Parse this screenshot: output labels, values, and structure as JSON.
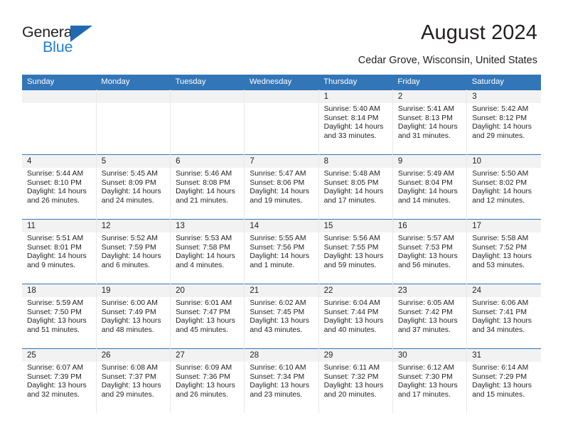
{
  "brand": {
    "name_part1": "General",
    "name_part2": "Blue",
    "triangle_color": "#1f69b0",
    "blue_text_color": "#1f7fd4"
  },
  "header": {
    "title": "August 2024",
    "subtitle": "Cedar Grove, Wisconsin, United States",
    "header_bg_color": "#3276b8",
    "daynum_bg_color": "#f2f2f2"
  },
  "weekday_headers": [
    "Sunday",
    "Monday",
    "Tuesday",
    "Wednesday",
    "Thursday",
    "Friday",
    "Saturday"
  ],
  "labels": {
    "sunrise_prefix": "Sunrise:",
    "sunset_prefix": "Sunset:",
    "daylight_prefix": "Daylight:"
  },
  "weeks": [
    [
      {
        "day": "",
        "sunrise": "",
        "sunset": "",
        "daylight_line1": "",
        "daylight_line2": ""
      },
      {
        "day": "",
        "sunrise": "",
        "sunset": "",
        "daylight_line1": "",
        "daylight_line2": ""
      },
      {
        "day": "",
        "sunrise": "",
        "sunset": "",
        "daylight_line1": "",
        "daylight_line2": ""
      },
      {
        "day": "",
        "sunrise": "",
        "sunset": "",
        "daylight_line1": "",
        "daylight_line2": ""
      },
      {
        "day": "1",
        "sunrise": "Sunrise: 5:40 AM",
        "sunset": "Sunset: 8:14 PM",
        "daylight_line1": "Daylight: 14 hours",
        "daylight_line2": "and 33 minutes."
      },
      {
        "day": "2",
        "sunrise": "Sunrise: 5:41 AM",
        "sunset": "Sunset: 8:13 PM",
        "daylight_line1": "Daylight: 14 hours",
        "daylight_line2": "and 31 minutes."
      },
      {
        "day": "3",
        "sunrise": "Sunrise: 5:42 AM",
        "sunset": "Sunset: 8:12 PM",
        "daylight_line1": "Daylight: 14 hours",
        "daylight_line2": "and 29 minutes."
      }
    ],
    [
      {
        "day": "4",
        "sunrise": "Sunrise: 5:44 AM",
        "sunset": "Sunset: 8:10 PM",
        "daylight_line1": "Daylight: 14 hours",
        "daylight_line2": "and 26 minutes."
      },
      {
        "day": "5",
        "sunrise": "Sunrise: 5:45 AM",
        "sunset": "Sunset: 8:09 PM",
        "daylight_line1": "Daylight: 14 hours",
        "daylight_line2": "and 24 minutes."
      },
      {
        "day": "6",
        "sunrise": "Sunrise: 5:46 AM",
        "sunset": "Sunset: 8:08 PM",
        "daylight_line1": "Daylight: 14 hours",
        "daylight_line2": "and 21 minutes."
      },
      {
        "day": "7",
        "sunrise": "Sunrise: 5:47 AM",
        "sunset": "Sunset: 8:06 PM",
        "daylight_line1": "Daylight: 14 hours",
        "daylight_line2": "and 19 minutes."
      },
      {
        "day": "8",
        "sunrise": "Sunrise: 5:48 AM",
        "sunset": "Sunset: 8:05 PM",
        "daylight_line1": "Daylight: 14 hours",
        "daylight_line2": "and 17 minutes."
      },
      {
        "day": "9",
        "sunrise": "Sunrise: 5:49 AM",
        "sunset": "Sunset: 8:04 PM",
        "daylight_line1": "Daylight: 14 hours",
        "daylight_line2": "and 14 minutes."
      },
      {
        "day": "10",
        "sunrise": "Sunrise: 5:50 AM",
        "sunset": "Sunset: 8:02 PM",
        "daylight_line1": "Daylight: 14 hours",
        "daylight_line2": "and 12 minutes."
      }
    ],
    [
      {
        "day": "11",
        "sunrise": "Sunrise: 5:51 AM",
        "sunset": "Sunset: 8:01 PM",
        "daylight_line1": "Daylight: 14 hours",
        "daylight_line2": "and 9 minutes."
      },
      {
        "day": "12",
        "sunrise": "Sunrise: 5:52 AM",
        "sunset": "Sunset: 7:59 PM",
        "daylight_line1": "Daylight: 14 hours",
        "daylight_line2": "and 6 minutes."
      },
      {
        "day": "13",
        "sunrise": "Sunrise: 5:53 AM",
        "sunset": "Sunset: 7:58 PM",
        "daylight_line1": "Daylight: 14 hours",
        "daylight_line2": "and 4 minutes."
      },
      {
        "day": "14",
        "sunrise": "Sunrise: 5:55 AM",
        "sunset": "Sunset: 7:56 PM",
        "daylight_line1": "Daylight: 14 hours",
        "daylight_line2": "and 1 minute."
      },
      {
        "day": "15",
        "sunrise": "Sunrise: 5:56 AM",
        "sunset": "Sunset: 7:55 PM",
        "daylight_line1": "Daylight: 13 hours",
        "daylight_line2": "and 59 minutes."
      },
      {
        "day": "16",
        "sunrise": "Sunrise: 5:57 AM",
        "sunset": "Sunset: 7:53 PM",
        "daylight_line1": "Daylight: 13 hours",
        "daylight_line2": "and 56 minutes."
      },
      {
        "day": "17",
        "sunrise": "Sunrise: 5:58 AM",
        "sunset": "Sunset: 7:52 PM",
        "daylight_line1": "Daylight: 13 hours",
        "daylight_line2": "and 53 minutes."
      }
    ],
    [
      {
        "day": "18",
        "sunrise": "Sunrise: 5:59 AM",
        "sunset": "Sunset: 7:50 PM",
        "daylight_line1": "Daylight: 13 hours",
        "daylight_line2": "and 51 minutes."
      },
      {
        "day": "19",
        "sunrise": "Sunrise: 6:00 AM",
        "sunset": "Sunset: 7:49 PM",
        "daylight_line1": "Daylight: 13 hours",
        "daylight_line2": "and 48 minutes."
      },
      {
        "day": "20",
        "sunrise": "Sunrise: 6:01 AM",
        "sunset": "Sunset: 7:47 PM",
        "daylight_line1": "Daylight: 13 hours",
        "daylight_line2": "and 45 minutes."
      },
      {
        "day": "21",
        "sunrise": "Sunrise: 6:02 AM",
        "sunset": "Sunset: 7:45 PM",
        "daylight_line1": "Daylight: 13 hours",
        "daylight_line2": "and 43 minutes."
      },
      {
        "day": "22",
        "sunrise": "Sunrise: 6:04 AM",
        "sunset": "Sunset: 7:44 PM",
        "daylight_line1": "Daylight: 13 hours",
        "daylight_line2": "and 40 minutes."
      },
      {
        "day": "23",
        "sunrise": "Sunrise: 6:05 AM",
        "sunset": "Sunset: 7:42 PM",
        "daylight_line1": "Daylight: 13 hours",
        "daylight_line2": "and 37 minutes."
      },
      {
        "day": "24",
        "sunrise": "Sunrise: 6:06 AM",
        "sunset": "Sunset: 7:41 PM",
        "daylight_line1": "Daylight: 13 hours",
        "daylight_line2": "and 34 minutes."
      }
    ],
    [
      {
        "day": "25",
        "sunrise": "Sunrise: 6:07 AM",
        "sunset": "Sunset: 7:39 PM",
        "daylight_line1": "Daylight: 13 hours",
        "daylight_line2": "and 32 minutes."
      },
      {
        "day": "26",
        "sunrise": "Sunrise: 6:08 AM",
        "sunset": "Sunset: 7:37 PM",
        "daylight_line1": "Daylight: 13 hours",
        "daylight_line2": "and 29 minutes."
      },
      {
        "day": "27",
        "sunrise": "Sunrise: 6:09 AM",
        "sunset": "Sunset: 7:36 PM",
        "daylight_line1": "Daylight: 13 hours",
        "daylight_line2": "and 26 minutes."
      },
      {
        "day": "28",
        "sunrise": "Sunrise: 6:10 AM",
        "sunset": "Sunset: 7:34 PM",
        "daylight_line1": "Daylight: 13 hours",
        "daylight_line2": "and 23 minutes."
      },
      {
        "day": "29",
        "sunrise": "Sunrise: 6:11 AM",
        "sunset": "Sunset: 7:32 PM",
        "daylight_line1": "Daylight: 13 hours",
        "daylight_line2": "and 20 minutes."
      },
      {
        "day": "30",
        "sunrise": "Sunrise: 6:12 AM",
        "sunset": "Sunset: 7:30 PM",
        "daylight_line1": "Daylight: 13 hours",
        "daylight_line2": "and 17 minutes."
      },
      {
        "day": "31",
        "sunrise": "Sunrise: 6:14 AM",
        "sunset": "Sunset: 7:29 PM",
        "daylight_line1": "Daylight: 13 hours",
        "daylight_line2": "and 15 minutes."
      }
    ]
  ]
}
